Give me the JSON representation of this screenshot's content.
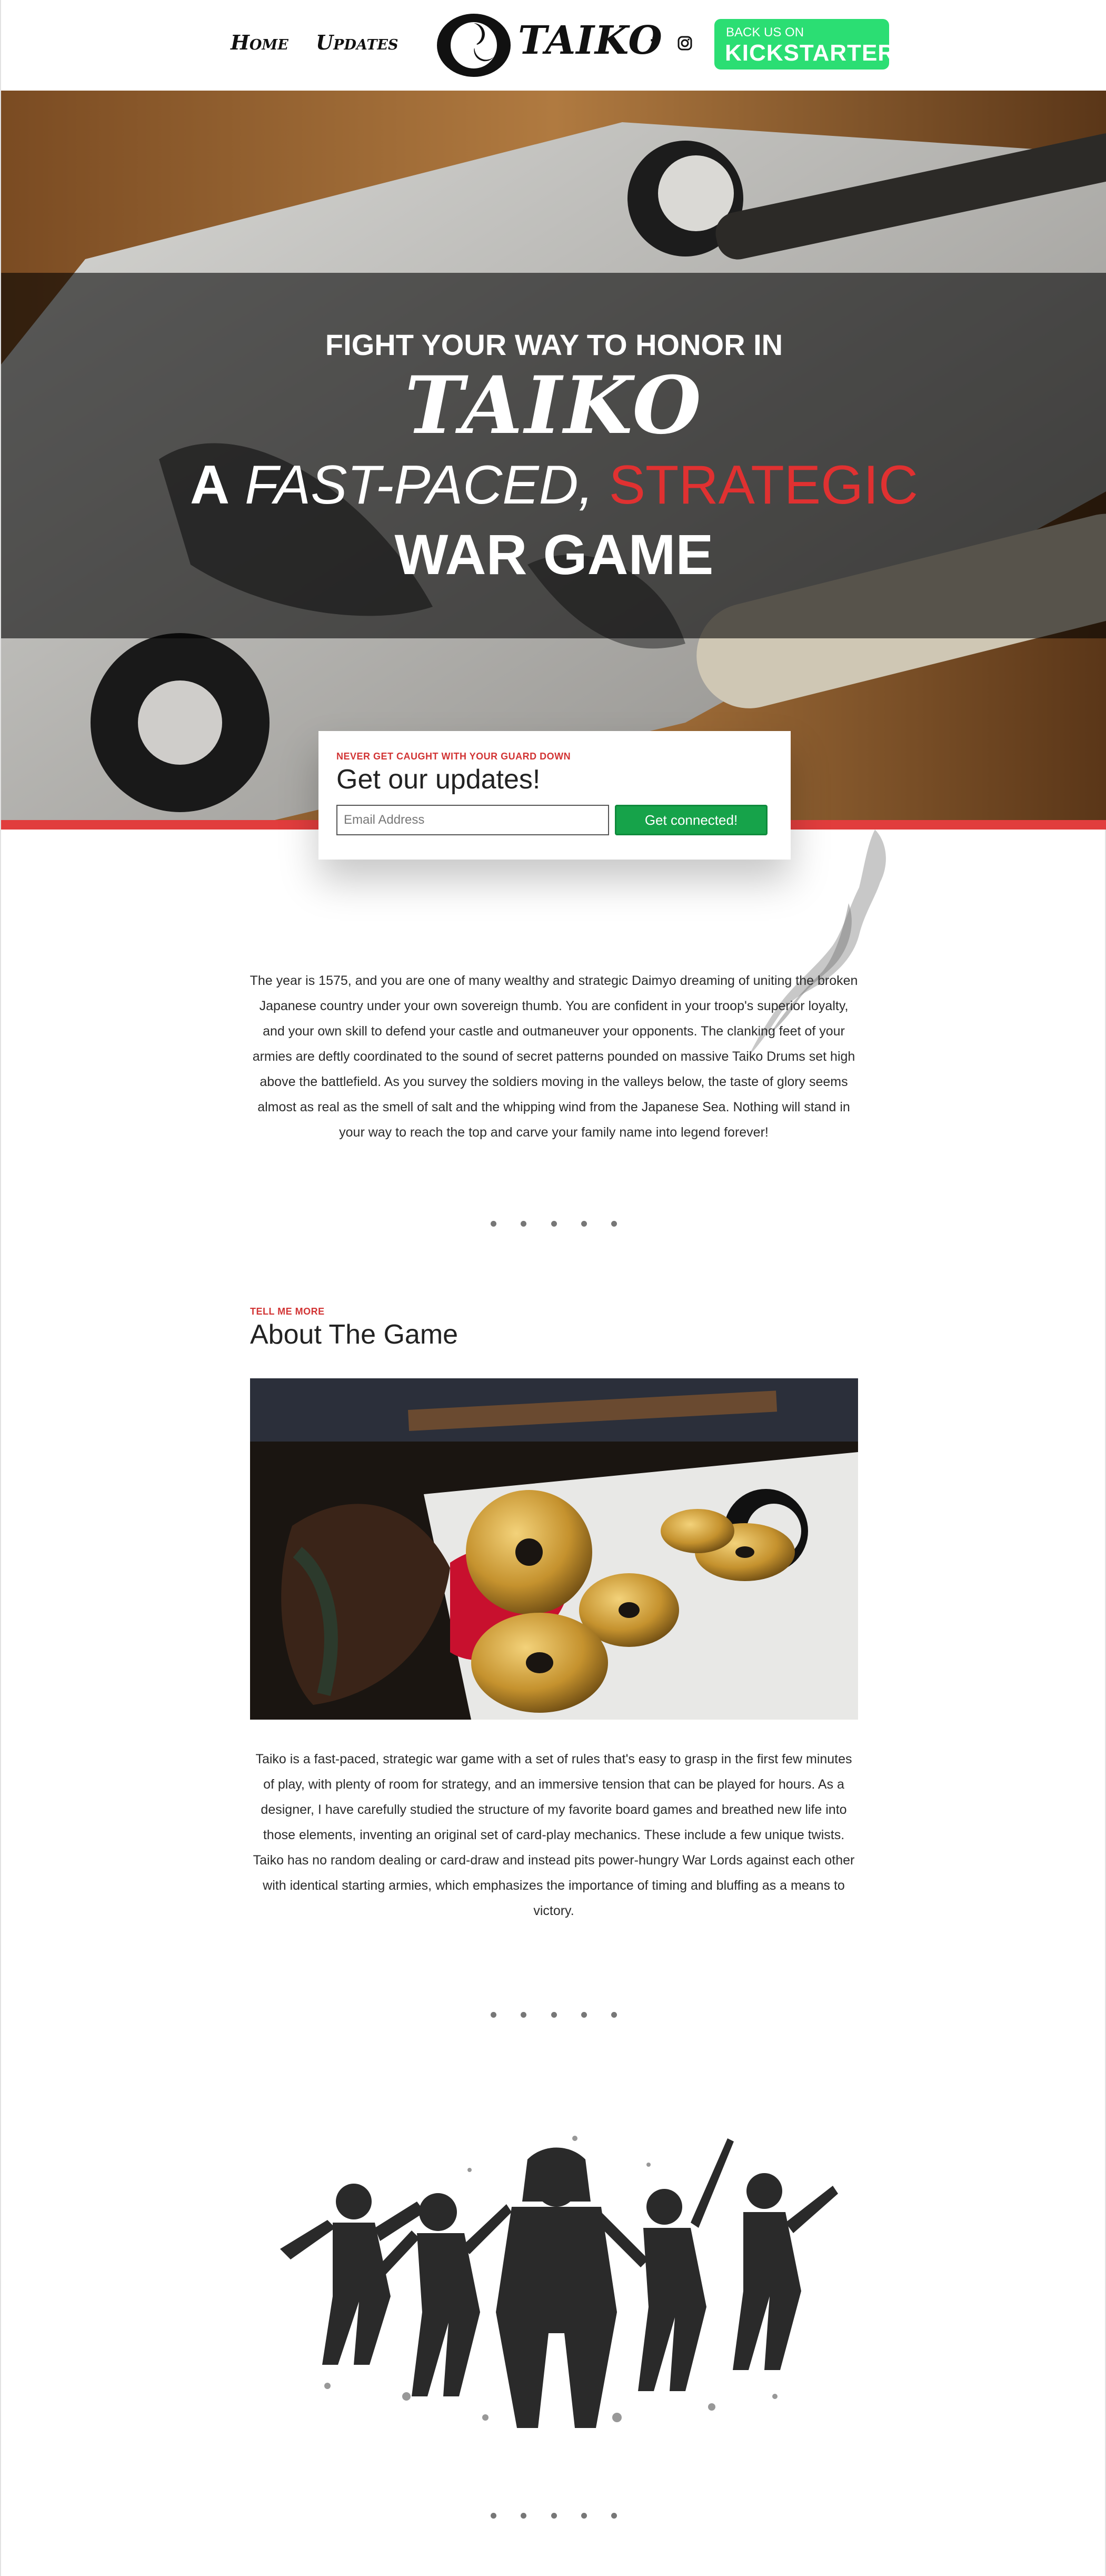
{
  "header": {
    "nav": [
      {
        "label": "Home"
      },
      {
        "label": "Updates"
      }
    ],
    "logo_text": "TAIKO",
    "social": {
      "facebook_icon": "f"
    },
    "kickstarter": {
      "small": "BACK US ON",
      "big": "KICKSTARTER",
      "color": "#2bde73"
    }
  },
  "hero": {
    "line1": "FIGHT YOUR WAY TO HONOR IN",
    "brand": "TAIKO",
    "line3_a": "A",
    "line3_fast": "FAST-PACED,",
    "line3_strategic": "STRATEGIC",
    "line4": "WAR GAME",
    "accent": "#e13d3d"
  },
  "signup": {
    "eyebrow": "NEVER GET CAUGHT WITH YOUR GUARD DOWN",
    "title": "Get our updates!",
    "email_placeholder": "Email Address",
    "button": "Get connected!"
  },
  "intro": {
    "text": "The year is 1575, and you are one of many wealthy and strategic Daimyo dreaming of uniting the broken Japanese country under your own sovereign thumb. You are confident in your troop's superior loyalty, and your own skill to defend your castle and outmaneuver your opponents. The clanking feet of your armies are deftly coordinated to the sound of secret patterns pounded on massive Taiko Drums set high above the battlefield. As you survey the soldiers moving in the valleys below, the taste of glory seems almost as real as the smell of salt and the whipping wind from the Japanese Sea. Nothing will stand in your way to reach the top and carve your family name into legend forever!"
  },
  "about": {
    "eyebrow": "TELL ME MORE",
    "title": "About The Game",
    "text": "Taiko is a fast-paced, strategic war game with a set of rules that's easy to grasp in the first few minutes of play, with plenty of room for strategy, and an immersive tension that can be played for hours. As a designer, I have carefully studied the structure of my favorite board games and breathed new life into those elements, inventing an original set of card-play mechanics. These include a few unique twists. Taiko has no random dealing or card-draw and instead pits power-hungry War Lords against each other with identical starting armies, which emphasizes the importance of timing and bluffing as a means to victory."
  }
}
